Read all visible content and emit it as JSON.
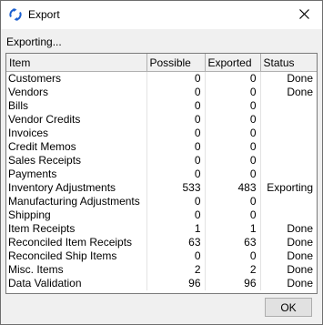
{
  "window": {
    "title": "Export"
  },
  "status_label": "Exporting...",
  "table": {
    "columns": [
      "Item",
      "Possible",
      "Exported",
      "Status"
    ],
    "rows": [
      [
        "Customers",
        "0",
        "0",
        "Done"
      ],
      [
        "Vendors",
        "0",
        "0",
        "Done"
      ],
      [
        "Bills",
        "0",
        "0",
        ""
      ],
      [
        "Vendor Credits",
        "0",
        "0",
        ""
      ],
      [
        "Invoices",
        "0",
        "0",
        ""
      ],
      [
        "Credit Memos",
        "0",
        "0",
        ""
      ],
      [
        "Sales Receipts",
        "0",
        "0",
        ""
      ],
      [
        "Payments",
        "0",
        "0",
        ""
      ],
      [
        "Inventory Adjustments",
        "533",
        "483",
        "Exporting"
      ],
      [
        "Manufacturing Adjustments",
        "0",
        "0",
        ""
      ],
      [
        "Shipping",
        "0",
        "0",
        ""
      ],
      [
        "Item Receipts",
        "1",
        "1",
        "Done"
      ],
      [
        "Reconciled Item Receipts",
        "63",
        "63",
        "Done"
      ],
      [
        "Reconciled Ship Items",
        "0",
        "0",
        "Done"
      ],
      [
        "Misc. Items",
        "2",
        "2",
        "Done"
      ],
      [
        "Data Validation",
        "96",
        "96",
        "Done"
      ]
    ]
  },
  "buttons": {
    "ok": "OK"
  },
  "icons": {
    "app": "sync-icon",
    "close": "close-icon"
  },
  "colors": {
    "app_icon": "#1a5fd0"
  }
}
